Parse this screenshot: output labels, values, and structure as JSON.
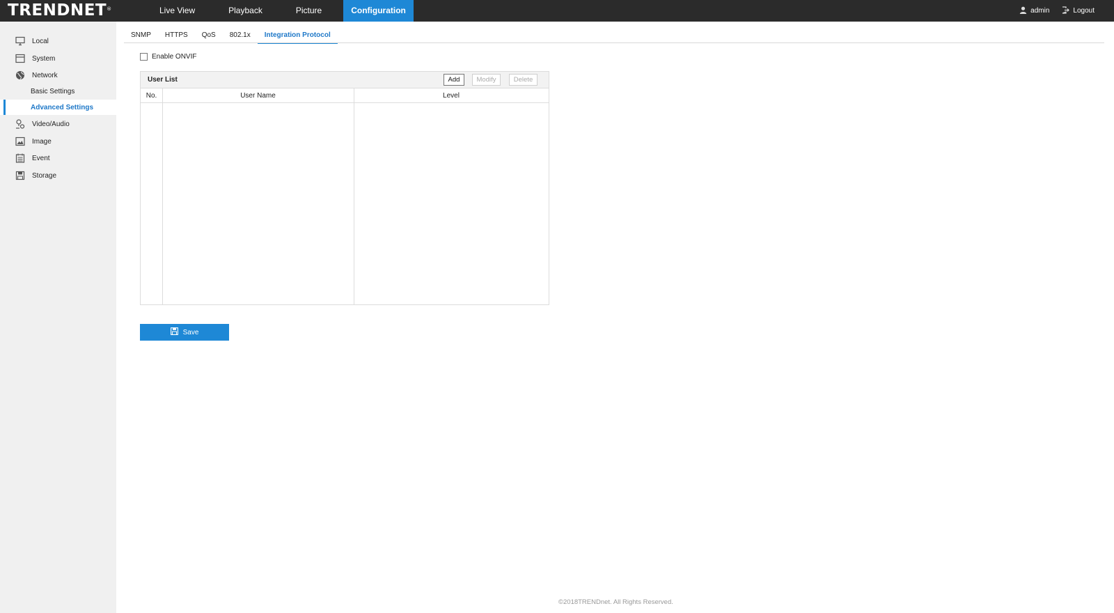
{
  "header": {
    "logo_text": "TRENDNET",
    "logo_mark": "®",
    "nav": [
      {
        "label": "Live View"
      },
      {
        "label": "Playback"
      },
      {
        "label": "Picture"
      },
      {
        "label": "Configuration"
      }
    ],
    "user_label": "admin",
    "logout_label": "Logout"
  },
  "sidebar": {
    "items": [
      {
        "label": "Local",
        "icon": "monitor-icon"
      },
      {
        "label": "System",
        "icon": "system-icon"
      },
      {
        "label": "Network",
        "icon": "globe-icon"
      },
      {
        "label": "Video/Audio",
        "icon": "video-audio-icon"
      },
      {
        "label": "Image",
        "icon": "image-icon"
      },
      {
        "label": "Event",
        "icon": "calendar-icon"
      },
      {
        "label": "Storage",
        "icon": "storage-icon"
      }
    ],
    "network_sub": [
      {
        "label": "Basic Settings"
      },
      {
        "label": "Advanced Settings"
      }
    ]
  },
  "tabs": [
    {
      "label": "SNMP"
    },
    {
      "label": "HTTPS"
    },
    {
      "label": "QoS"
    },
    {
      "label": "802.1x"
    },
    {
      "label": "Integration Protocol"
    }
  ],
  "onvif": {
    "label": "Enable ONVIF",
    "checked": false
  },
  "user_list": {
    "title": "User List",
    "add_label": "Add",
    "modify_label": "Modify",
    "delete_label": "Delete",
    "columns": [
      "No.",
      "User Name",
      "Level"
    ],
    "rows": []
  },
  "save_label": "Save",
  "footer": "©2018TRENDnet. All Rights Reserved.",
  "colors": {
    "accent": "#1e88d6",
    "topbar": "#2b2b2b",
    "sidebar": "#f0f0f0"
  }
}
